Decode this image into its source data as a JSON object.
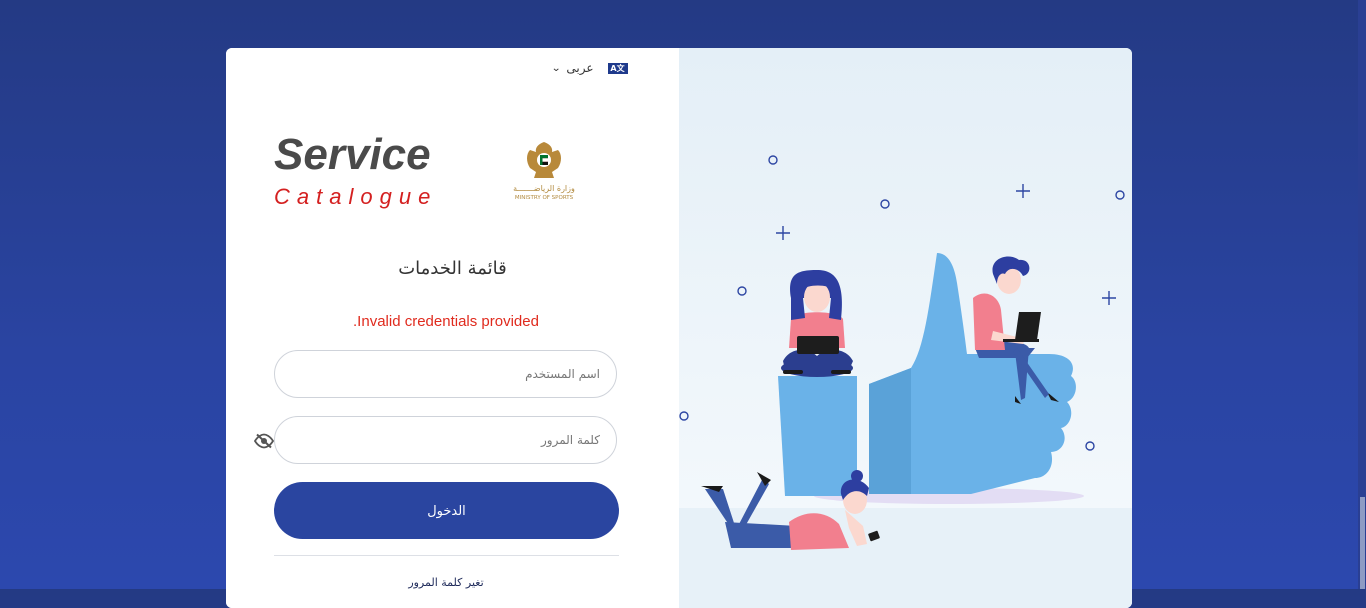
{
  "language": {
    "label": "عربى",
    "icon": "translate-icon",
    "chevron": "chevron-down-icon"
  },
  "logo": {
    "line1": "Service",
    "line2": "Catalogue"
  },
  "ministry": {
    "name_ar": "وزارة الرياضـــــــة",
    "name_en": "MINISTRY OF SPORTS"
  },
  "title": "قائمة الخدمات",
  "error": ".Invalid credentials provided",
  "form": {
    "username_placeholder": "اسم المستخدم",
    "password_placeholder": "كلمة المرور",
    "login_label": "الدخول",
    "change_password_label": "تغير كلمة المرور"
  },
  "colors": {
    "primary": "#2a45a0",
    "error": "#e02b1e",
    "background": "#243a84",
    "thumb": "#6ab2e8"
  }
}
